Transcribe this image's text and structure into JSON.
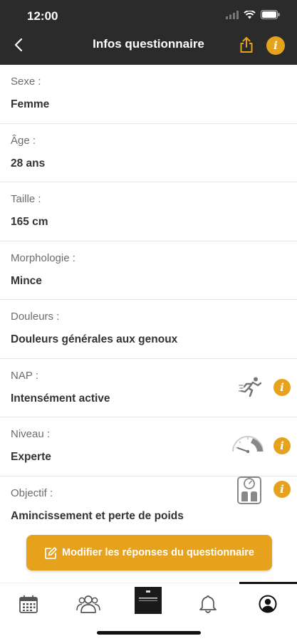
{
  "status_bar": {
    "time": "12:00"
  },
  "header": {
    "title": "Infos questionnaire"
  },
  "fields": [
    {
      "label": "Sexe :",
      "value": "Femme"
    },
    {
      "label": "Âge :",
      "value": "28 ans"
    },
    {
      "label": "Taille :",
      "value": "165 cm"
    },
    {
      "label": "Morphologie :",
      "value": "Mince"
    },
    {
      "label": "Douleurs :",
      "value": "Douleurs générales aux genoux"
    },
    {
      "label": "NAP :",
      "value": "Intensément active",
      "icon": "running-person-icon"
    },
    {
      "label": "Niveau :",
      "value": "Experte",
      "icon": "gauge-icon"
    },
    {
      "label": "Objectif :",
      "value": "Amincissement et perte de poids",
      "icon": "scale-icon"
    }
  ],
  "info_glyph": "i",
  "cta": {
    "label": "Modifier les réponses du questionnaire",
    "icon": "edit-icon"
  },
  "tabbar": {
    "items": [
      "calendar-icon",
      "community-icon",
      "program-icon",
      "bell-icon",
      "profile-icon"
    ],
    "active": "profile-icon"
  },
  "colors": {
    "header_bg": "#2b2b2b",
    "accent": "#e6a21c",
    "label": "#6c6c6c",
    "value": "#333333",
    "divider": "#e6e6e6"
  }
}
